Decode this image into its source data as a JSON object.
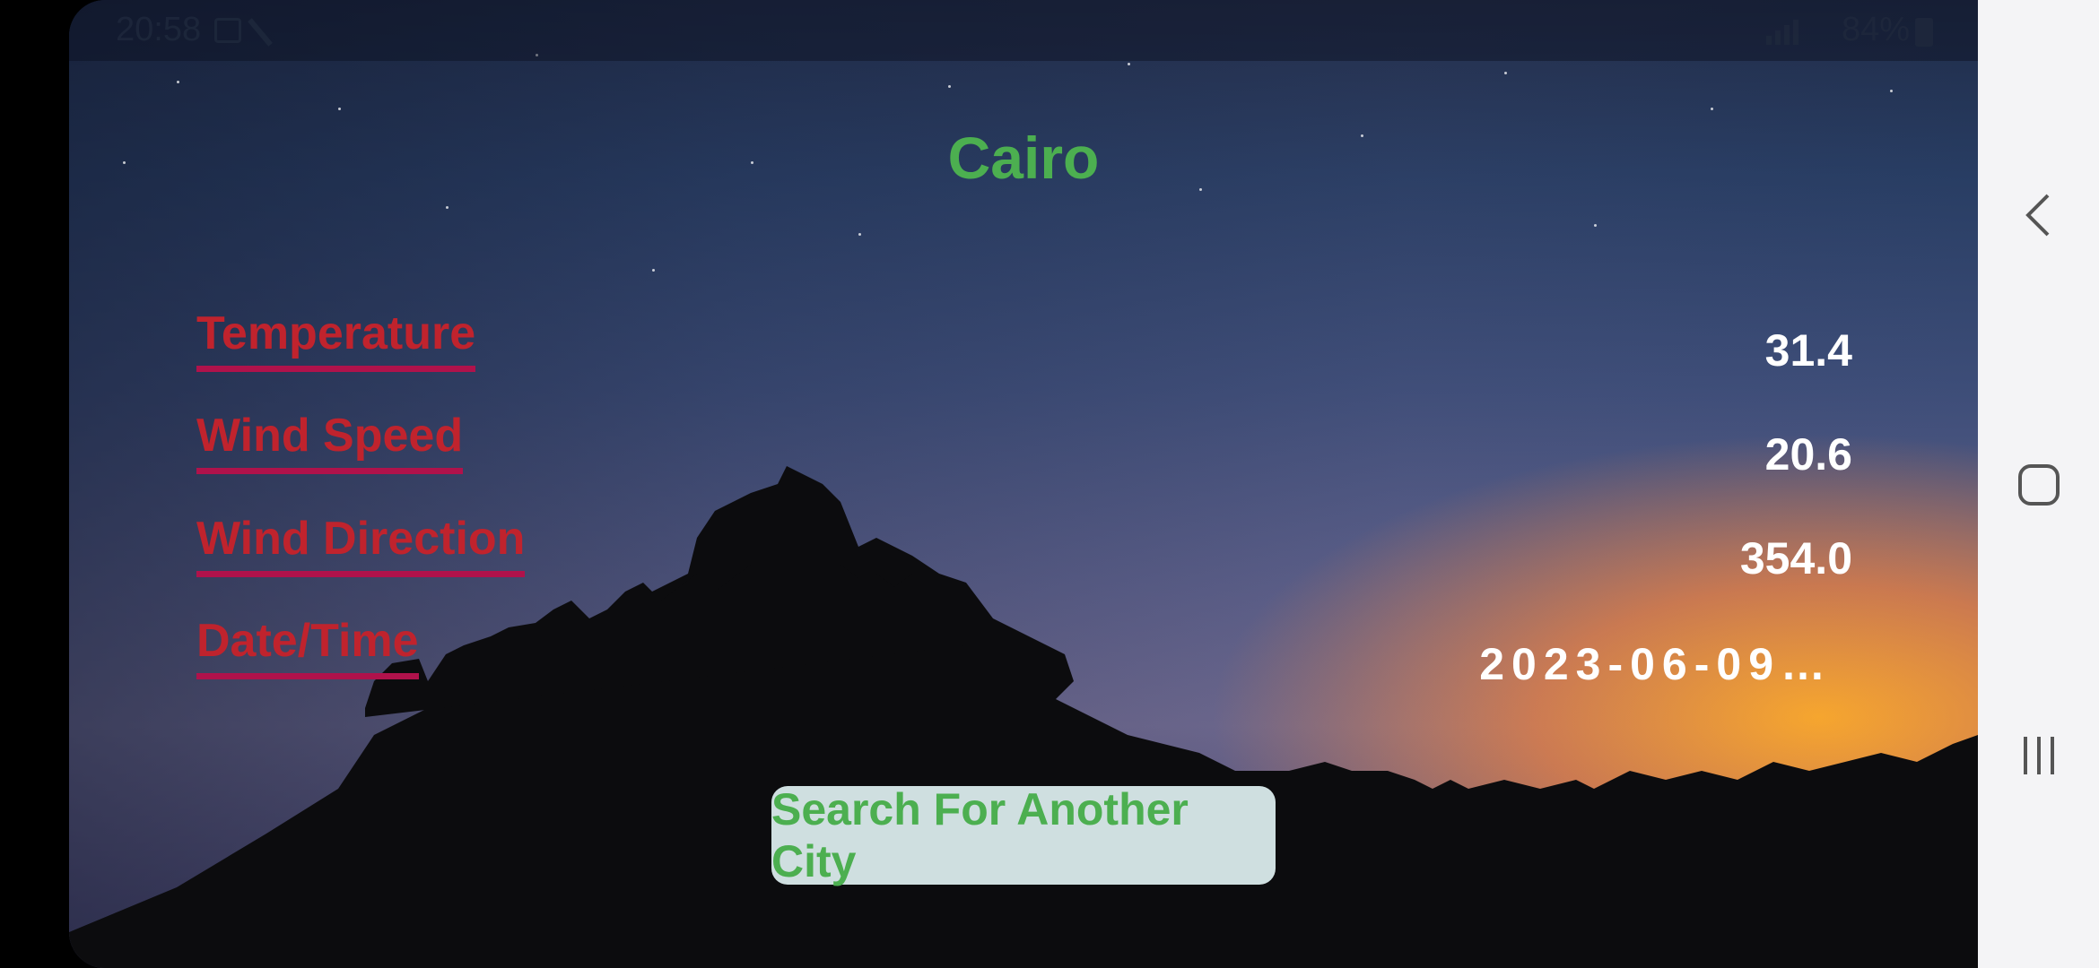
{
  "status_bar": {
    "time": "20:58",
    "battery": "84%"
  },
  "city": "Cairo",
  "rows": [
    {
      "label": "Temperature",
      "value": "31.4"
    },
    {
      "label": "Wind Speed",
      "value": "20.6"
    },
    {
      "label": "Wind Direction",
      "value": "354.0"
    },
    {
      "label": "Date/Time",
      "value": "2023-06-09…"
    }
  ],
  "search_button": "Search For Another City",
  "colors": {
    "title": "#4caf50",
    "label": "#c0232d",
    "underline": "#b0124b",
    "button_bg": "#cfdfe0"
  },
  "icons": {
    "nav_back": "chevron-left-icon",
    "nav_home": "home-icon",
    "nav_recents": "recents-icon"
  }
}
